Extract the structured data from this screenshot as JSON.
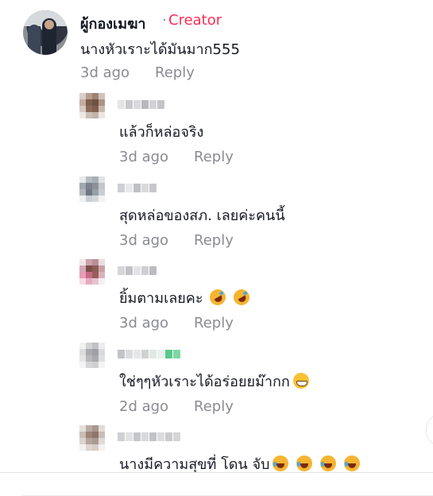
{
  "parent_comment": {
    "username": "ผู้กองเมฆา",
    "separator": "·",
    "badge": "Creator",
    "text": "นางหัวเราะได้มันมาก555",
    "time": "3d ago",
    "reply_label": "Reply"
  },
  "replies": [
    {
      "text": "แล้วก็หล่อจริง",
      "time": "3d ago",
      "reply_label": "Reply",
      "emoji": []
    },
    {
      "text": "สุดหล่อของสภ. เลยค่ะคนนี้",
      "time": "3d ago",
      "reply_label": "Reply",
      "emoji": []
    },
    {
      "text": "ยิ้มตามเลยคะ",
      "time": "3d ago",
      "reply_label": "Reply",
      "emoji": [
        "rolling-on-floor-laughing",
        "rolling-on-floor-laughing"
      ]
    },
    {
      "text": "ใช่ๆๆหัวเราะได้อร่อยยม๊ากก",
      "time": "2d ago",
      "reply_label": "Reply",
      "emoji": [
        "grinning-face"
      ]
    },
    {
      "text": "นางมีความสุขที่ โดน จับ",
      "time": "",
      "reply_label": "",
      "emoji": [
        "face-with-tears-of-joy",
        "face-with-tears-of-joy",
        "face-with-tears-of-joy",
        "face-with-tears-of-joy"
      ]
    }
  ],
  "colors": {
    "creator_badge": "#fe2c55",
    "meta_text": "#8a8b91",
    "primary_text": "#161823"
  }
}
